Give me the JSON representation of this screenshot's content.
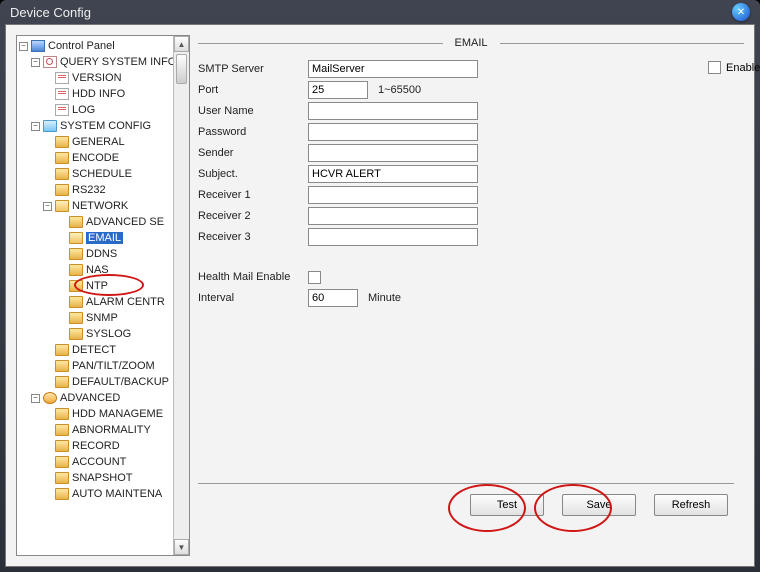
{
  "window": {
    "title": "Device Config"
  },
  "tree": {
    "root": "Control Panel",
    "query_info": "QUERY SYSTEM INFO",
    "version": "VERSION",
    "hdd_info": "HDD INFO",
    "log": "LOG",
    "system_config": "SYSTEM CONFIG",
    "general": "GENERAL",
    "encode": "ENCODE",
    "schedule": "SCHEDULE",
    "rs232": "RS232",
    "network": "NETWORK",
    "advanced_se": "ADVANCED SE",
    "email": "EMAIL",
    "ddns": "DDNS",
    "nas": "NAS",
    "ntp": "NTP",
    "alarm_centre": "ALARM CENTR",
    "snmp": "SNMP",
    "syslog": "SYSLOG",
    "detect": "DETECT",
    "pantilt": "PAN/TILT/ZOOM",
    "default_backup": "DEFAULT/BACKUP",
    "advanced": "ADVANCED",
    "hdd_mgmt": "HDD MANAGEME",
    "abnormality": "ABNORMALITY",
    "record": "RECORD",
    "account": "ACCOUNT",
    "snapshot": "SNAPSHOT",
    "auto_maint": "AUTO MAINTENA"
  },
  "section": {
    "title": "EMAIL"
  },
  "form": {
    "labels": {
      "smtp": "SMTP Server",
      "port": "Port",
      "user": "User Name",
      "pass": "Password",
      "sender": "Sender",
      "subject": "Subject.",
      "r1": "Receiver 1",
      "r2": "Receiver 2",
      "r3": "Receiver 3",
      "health": "Health Mail Enable",
      "interval": "Interval",
      "minute": "Minute",
      "enable": "Enable"
    },
    "values": {
      "smtp": "MailServer",
      "port": "25",
      "port_hint": "1~65500",
      "user": "",
      "pass": "",
      "sender": "",
      "subject": "HCVR ALERT",
      "r1": "",
      "r2": "",
      "r3": "",
      "interval": "60"
    }
  },
  "buttons": {
    "test": "Test",
    "save": "Save",
    "refresh": "Refresh"
  }
}
